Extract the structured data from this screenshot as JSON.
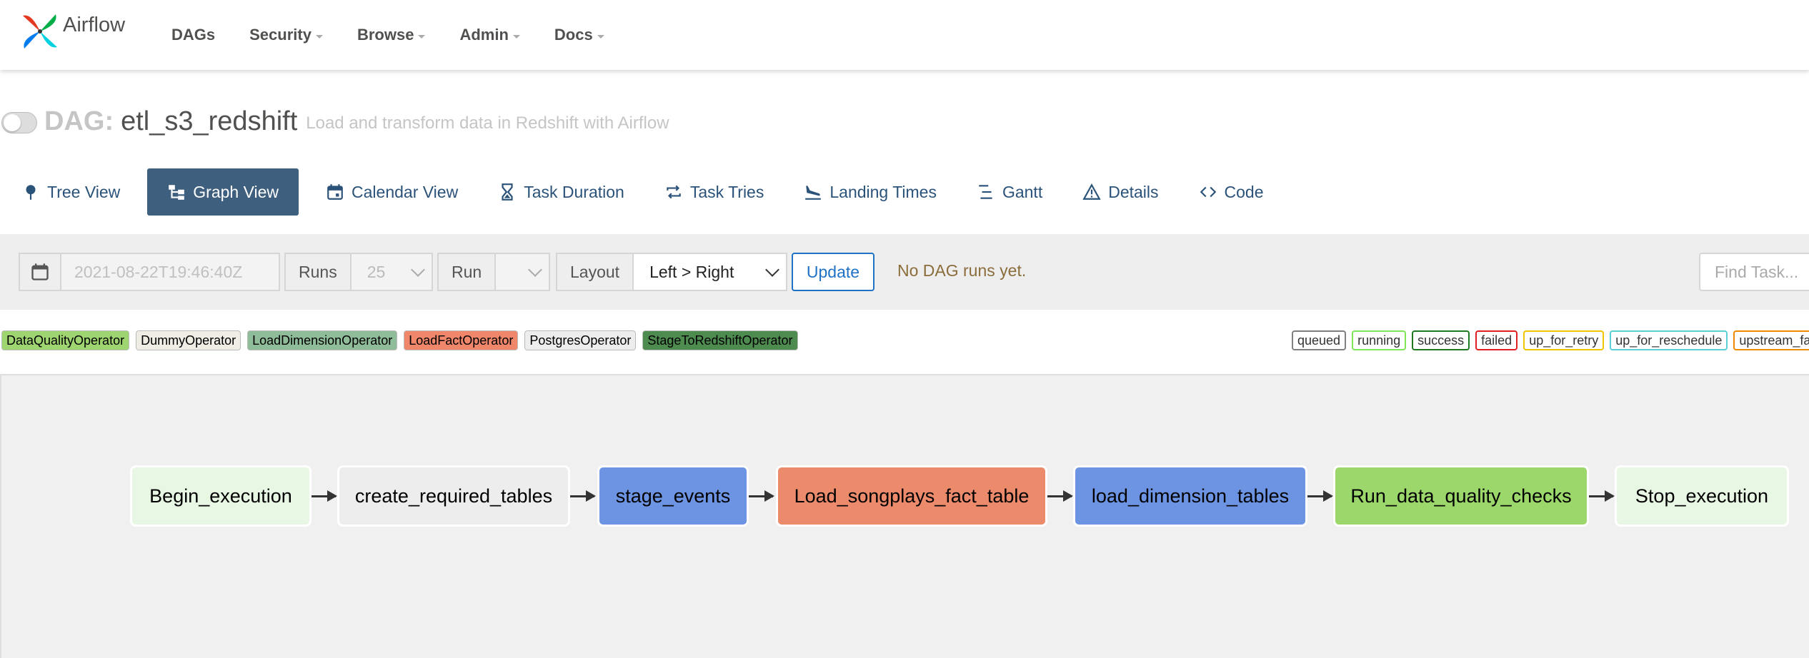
{
  "app": {
    "name": "Airflow"
  },
  "nav": {
    "items": [
      "DAGs",
      "Security",
      "Browse",
      "Admin",
      "Docs"
    ]
  },
  "dag": {
    "prefix": "DAG:",
    "id": "etl_s3_redshift",
    "description": "Load and transform data in Redshift with Airflow"
  },
  "tabs": [
    {
      "label": "Tree View",
      "icon": "tree-view-icon",
      "active": false
    },
    {
      "label": "Graph View",
      "icon": "graph-view-icon",
      "active": true
    },
    {
      "label": "Calendar View",
      "icon": "calendar-icon",
      "active": false
    },
    {
      "label": "Task Duration",
      "icon": "hourglass-icon",
      "active": false
    },
    {
      "label": "Task Tries",
      "icon": "repeat-icon",
      "active": false
    },
    {
      "label": "Landing Times",
      "icon": "plane-landing-icon",
      "active": false
    },
    {
      "label": "Gantt",
      "icon": "gantt-icon",
      "active": false
    },
    {
      "label": "Details",
      "icon": "warning-icon",
      "active": false
    },
    {
      "label": "Code",
      "icon": "code-icon",
      "active": false
    }
  ],
  "controls": {
    "base_date": "2021-08-22T19:46:40Z",
    "runs_label": "Runs",
    "runs_value": "25",
    "run_label": "Run",
    "run_value": "",
    "layout_label": "Layout",
    "layout_value": "Left > Right",
    "update_label": "Update",
    "status_text": "No DAG runs yet.",
    "find_placeholder": "Find Task..."
  },
  "operators": [
    {
      "label": "DataQualityOperator",
      "color": "#9fd571"
    },
    {
      "label": "DummyOperator",
      "color": "#f0ede4"
    },
    {
      "label": "LoadDimensionOperator",
      "color": "#8fbc99"
    },
    {
      "label": "LoadFactOperator",
      "color": "#f0866a"
    },
    {
      "label": "PostgresOperator",
      "color": "#ededed"
    },
    {
      "label": "StageToRedshiftOperator",
      "color": "#4d8b4f"
    }
  ],
  "states": [
    {
      "label": "queued",
      "color": "#808080"
    },
    {
      "label": "running",
      "color": "#7fe65a"
    },
    {
      "label": "success",
      "color": "#1f7a1f"
    },
    {
      "label": "failed",
      "color": "#e02020"
    },
    {
      "label": "up_for_retry",
      "color": "#f0c400"
    },
    {
      "label": "up_for_reschedule",
      "color": "#5ad0d6"
    },
    {
      "label": "upstream_failed",
      "color": "#f08a00"
    }
  ],
  "graph": {
    "nodes": [
      {
        "label": "Begin_execution",
        "color": "#e8f7e4"
      },
      {
        "label": "create_required_tables",
        "color": "#ededed"
      },
      {
        "label": "stage_events",
        "color": "#6d94e2"
      },
      {
        "label": "Load_songplays_fact_table",
        "color": "#ec8b6c"
      },
      {
        "label": "load_dimension_tables",
        "color": "#6d94e2"
      },
      {
        "label": "Run_data_quality_checks",
        "color": "#9bd76b"
      },
      {
        "label": "Stop_execution",
        "color": "#e8f7e4"
      }
    ]
  }
}
